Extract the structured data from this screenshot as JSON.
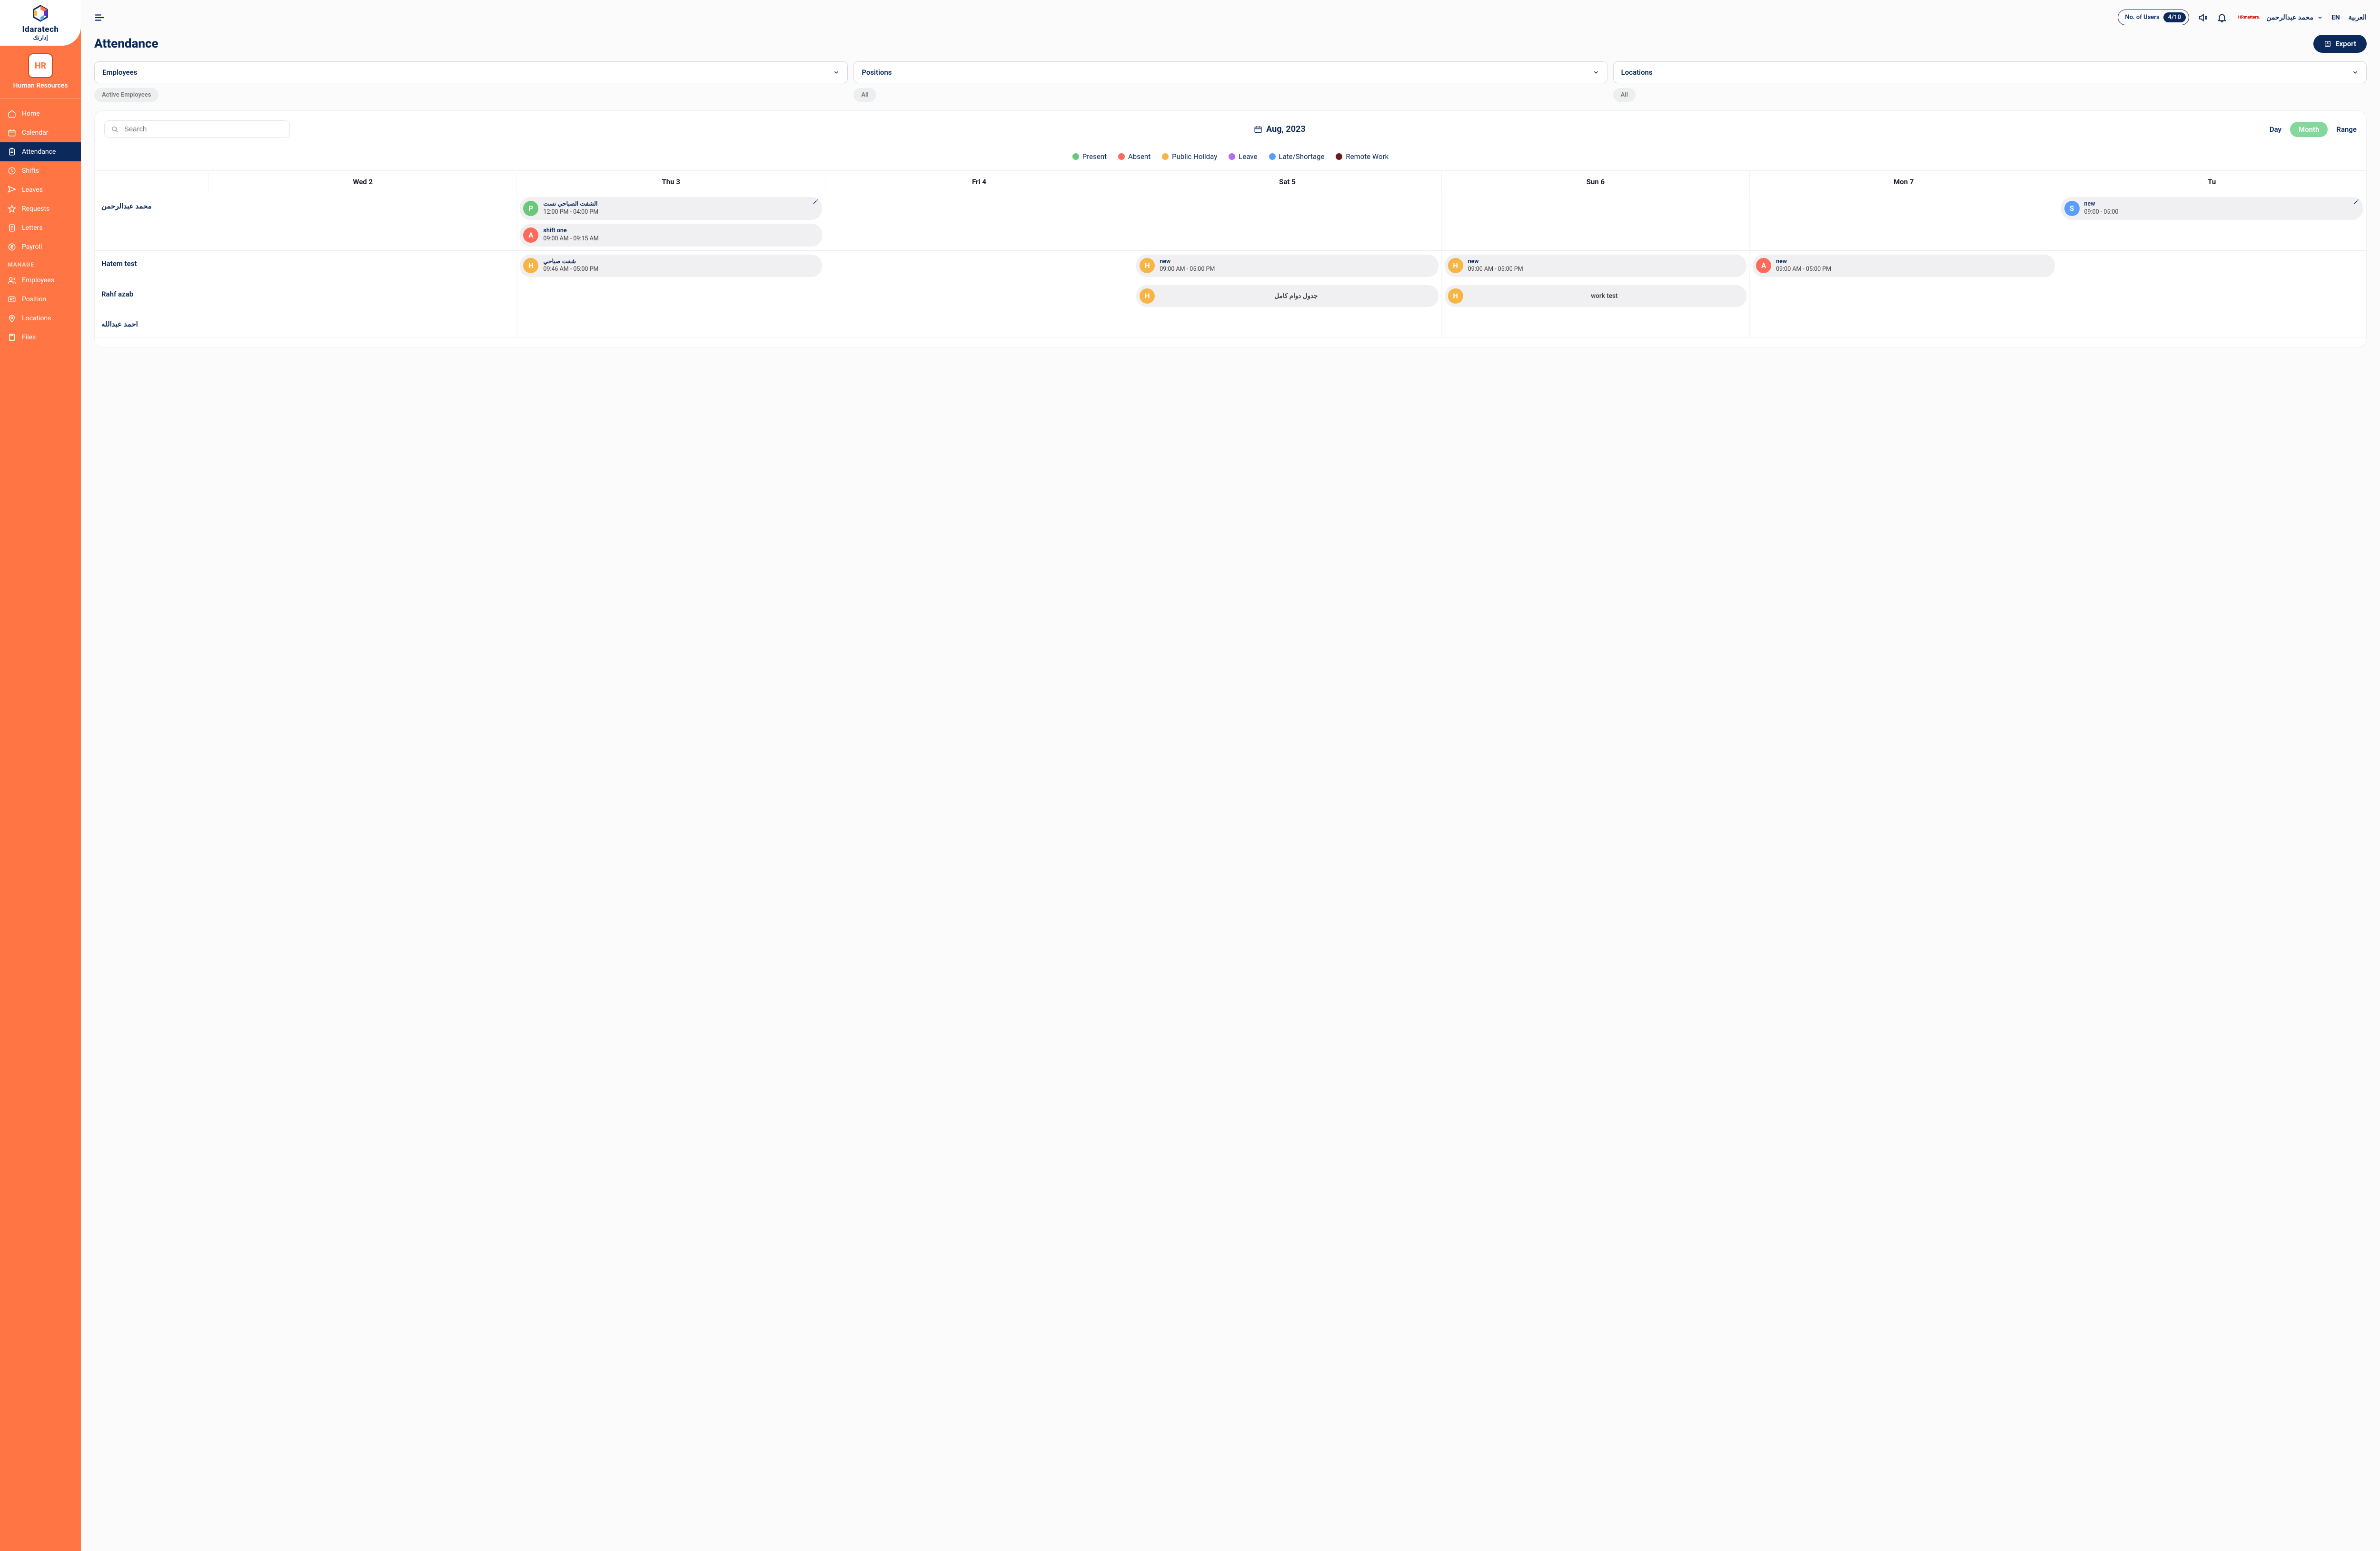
{
  "brand": {
    "title": "Idaratech",
    "subtitle": "إدارتك"
  },
  "module": {
    "badge": "HR",
    "name": "Human Resources"
  },
  "nav": {
    "home": "Home",
    "calendar": "Calendar",
    "attendance": "Attendance",
    "shifts": "Shifts",
    "leaves": "Leaves",
    "requests": "Requests",
    "letters": "Letters",
    "payroll": "Payroll",
    "manage": "MANAGE",
    "employees": "Employees",
    "position": "Position",
    "locations": "Locations",
    "files": "Files"
  },
  "topbar": {
    "users_label": "No. of Users",
    "users_count": "4/10",
    "profile_brand": "HRmatters.",
    "profile_name": "محمد عبدالرحمن",
    "lang_en": "EN",
    "lang_ar": "العربية"
  },
  "page": {
    "title": "Attendance",
    "export": "Export"
  },
  "filters": {
    "employees": {
      "label": "Employees",
      "chip": "Active Employees"
    },
    "positions": {
      "label": "Positions",
      "chip": "All"
    },
    "locations": {
      "label": "Locations",
      "chip": "All"
    }
  },
  "search": {
    "placeholder": "Search"
  },
  "date_label": "Aug, 2023",
  "views": {
    "day": "Day",
    "month": "Month",
    "range": "Range"
  },
  "legend": {
    "present": "Present",
    "absent": "Absent",
    "public_holiday": "Public Holiday",
    "leave": "Leave",
    "late": "Late/Shortage",
    "remote": "Remote Work"
  },
  "colors": {
    "present": "#68c97a",
    "absent": "#ff6b5b",
    "holiday": "#f6b545",
    "leave": "#b76bf0",
    "late": "#5b9dff",
    "remote": "#6b1c1c"
  },
  "columns": [
    "Wed 2",
    "Thu 3",
    "Fri 4",
    "Sat 5",
    "Sun 6",
    "Mon 7",
    "Tu"
  ],
  "rows": [
    {
      "name": "محمد عبدالرحمن",
      "cells": [
        [],
        [
          {
            "code": "P",
            "color": "#68c97a",
            "title": "الشفت الصباحي تست",
            "time": "12:00 PM - 04:00 PM",
            "edit": true
          },
          {
            "code": "A",
            "color": "#ff6b5b",
            "title": "shift one",
            "time": "09:00 AM - 09:15 AM"
          }
        ],
        [],
        [],
        [],
        [],
        [
          {
            "code": "S",
            "color": "#5b9dff",
            "title": "new",
            "time": "09:00 - 05:00",
            "edit": true
          }
        ]
      ]
    },
    {
      "name": "Hatem test",
      "cells": [
        [],
        [
          {
            "code": "H",
            "color": "#f6b545",
            "title": "شفت صباحي",
            "time": "09:46 AM - 05:00 PM"
          }
        ],
        [],
        [
          {
            "code": "H",
            "color": "#f6b545",
            "title": "new",
            "time": "09:00 AM - 05:00 PM"
          }
        ],
        [
          {
            "code": "H",
            "color": "#f6b545",
            "title": "new",
            "time": "09:00 AM - 05:00 PM"
          }
        ],
        [
          {
            "code": "A",
            "color": "#ff6b5b",
            "title": "new",
            "time": "09:00 AM - 05:00 PM"
          }
        ],
        []
      ]
    },
    {
      "name": "Rahf azab",
      "cells": [
        [],
        [],
        [],
        [
          {
            "code": "H",
            "color": "#f6b545",
            "center": "جدول دوام كامل"
          }
        ],
        [
          {
            "code": "H",
            "color": "#f6b545",
            "center": "work test"
          }
        ],
        [],
        []
      ]
    },
    {
      "name": "احمد عبدالله",
      "cells": [
        [],
        [],
        [],
        [],
        [],
        [],
        []
      ]
    }
  ]
}
